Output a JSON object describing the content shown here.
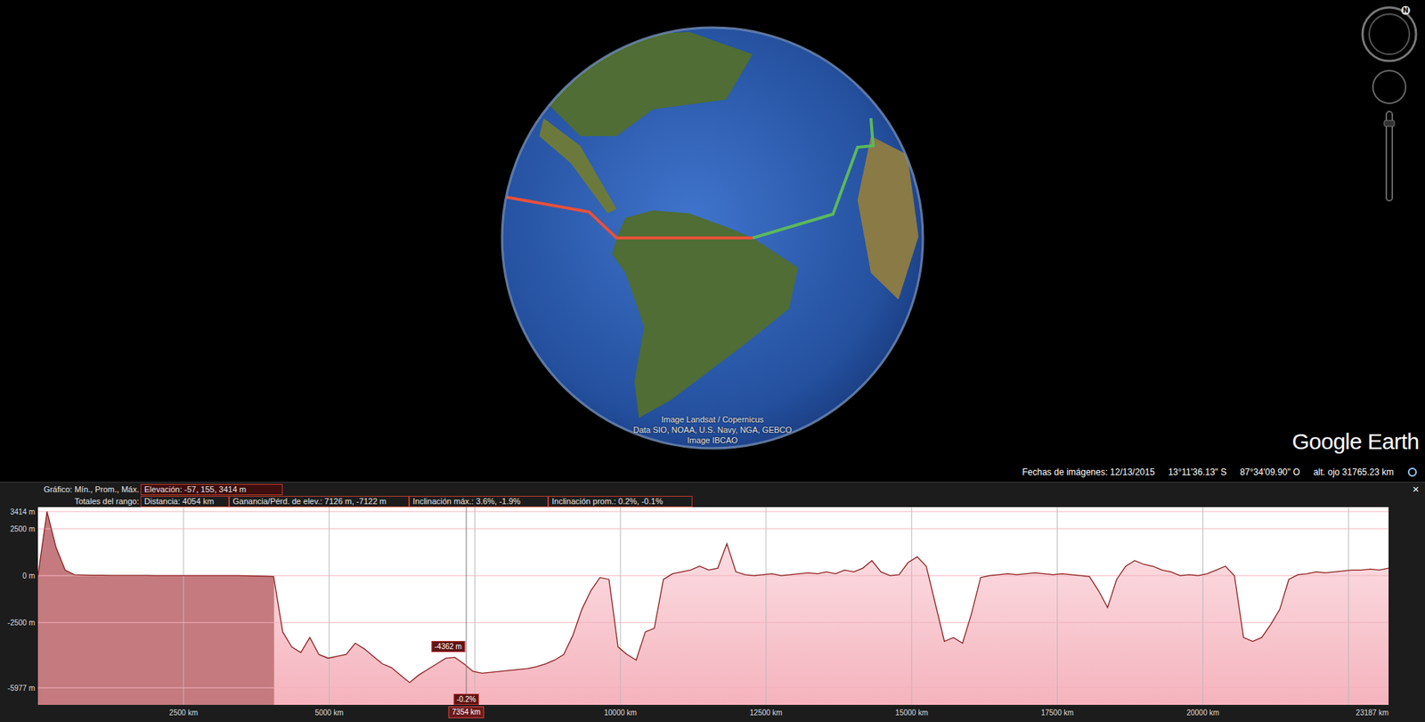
{
  "map": {
    "attribution": [
      "Image Landsat / Copernicus",
      "Data SIO, NOAA, U.S. Navy, NGA, GEBCO",
      "Image IBCAO"
    ],
    "logo": "Google Earth",
    "compass_label": "N",
    "routes": [
      {
        "color": "#e8503a"
      },
      {
        "color": "#5cb85c"
      }
    ]
  },
  "status_bar": {
    "imagery_date": "Fechas de imágenes: 12/13/2015",
    "latitude": "13°11'36.13\" S",
    "longitude": "87°34'09.90\" O",
    "eye_altitude": "alt. ojo 31765.23 km"
  },
  "profile": {
    "close": "×",
    "summary_label": "Gráfico: Mín., Prom., Máx.",
    "summary": [
      "Elevación: -57, 155, 3414 m"
    ],
    "range_label": "Totales del rango:",
    "range_totals": [
      "Distancia: 4054 km",
      "Ganancia/Pérd. de elev.: 7126 m, -7122 m",
      "Inclinación máx.: 3.6%, -1.9%",
      "Inclinación prom.: 0.2%, -0.1%"
    ],
    "chart": {
      "x_max_km": 23187,
      "y_min": -5977,
      "y_max": 3414,
      "y_ticks": [
        {
          "label": "3414 m",
          "value": 3414
        },
        {
          "label": "2500 m",
          "value": 2500
        },
        {
          "label": "0 m",
          "value": 0
        },
        {
          "label": "-2500 m",
          "value": -2500
        },
        {
          "label": "-5977 m",
          "value": -5977
        }
      ],
      "x_ticks": [
        {
          "label": "2500 km",
          "value": 2500
        },
        {
          "label": "5000 km",
          "value": 5000
        },
        {
          "label": "10000 km",
          "value": 10000
        },
        {
          "label": "12500 km",
          "value": 12500
        },
        {
          "label": "15000 km",
          "value": 15000
        },
        {
          "label": "17500 km",
          "value": 17500
        },
        {
          "label": "20000 km",
          "value": 20000
        },
        {
          "label": "23187 km",
          "value": 23187
        }
      ],
      "series": [
        {
          "name": "Elevación",
          "color": "#8b1c1c",
          "values": [
            0,
            3414,
            1500,
            300,
            50,
            30,
            20,
            20,
            10,
            10,
            10,
            10,
            10,
            0,
            0,
            0,
            0,
            0,
            0,
            0,
            0,
            0,
            0,
            -10,
            -20,
            -30,
            -50,
            -3000,
            -3800,
            -4100,
            -3300,
            -4200,
            -4400,
            -4300,
            -4200,
            -3600,
            -3900,
            -4300,
            -4700,
            -4900,
            -5300,
            -5700,
            -5300,
            -5000,
            -4700,
            -4400,
            -4362,
            -4700,
            -5100,
            -5200,
            -5150,
            -5100,
            -5050,
            -5000,
            -4950,
            -4850,
            -4700,
            -4500,
            -4200,
            -3200,
            -1800,
            -800,
            -100,
            -200,
            -3800,
            -4200,
            -4500,
            -3000,
            -2800,
            -200,
            100,
            200,
            300,
            500,
            300,
            400,
            1700,
            200,
            50,
            0,
            50,
            100,
            0,
            50,
            100,
            150,
            100,
            200,
            100,
            300,
            200,
            400,
            800,
            200,
            0,
            50,
            700,
            1000,
            500,
            -1500,
            -3500,
            -3300,
            -3600,
            -2000,
            -100,
            0,
            50,
            100,
            50,
            100,
            150,
            100,
            50,
            100,
            50,
            0,
            -50,
            -800,
            -1700,
            -200,
            500,
            800,
            600,
            500,
            300,
            200,
            0,
            50,
            0,
            100,
            300,
            500,
            0,
            -3300,
            -3500,
            -3300,
            -2600,
            -1800,
            -200,
            50,
            100,
            200,
            150,
            200,
            250,
            300,
            300,
            350,
            300,
            400
          ]
        }
      ],
      "selection": {
        "start_km": 0,
        "end_km": 4054
      },
      "cursor": {
        "km": 7354,
        "label": "7354 km",
        "value": -4362,
        "elevation": "-4362 m",
        "slope": "-0.2%"
      }
    }
  }
}
